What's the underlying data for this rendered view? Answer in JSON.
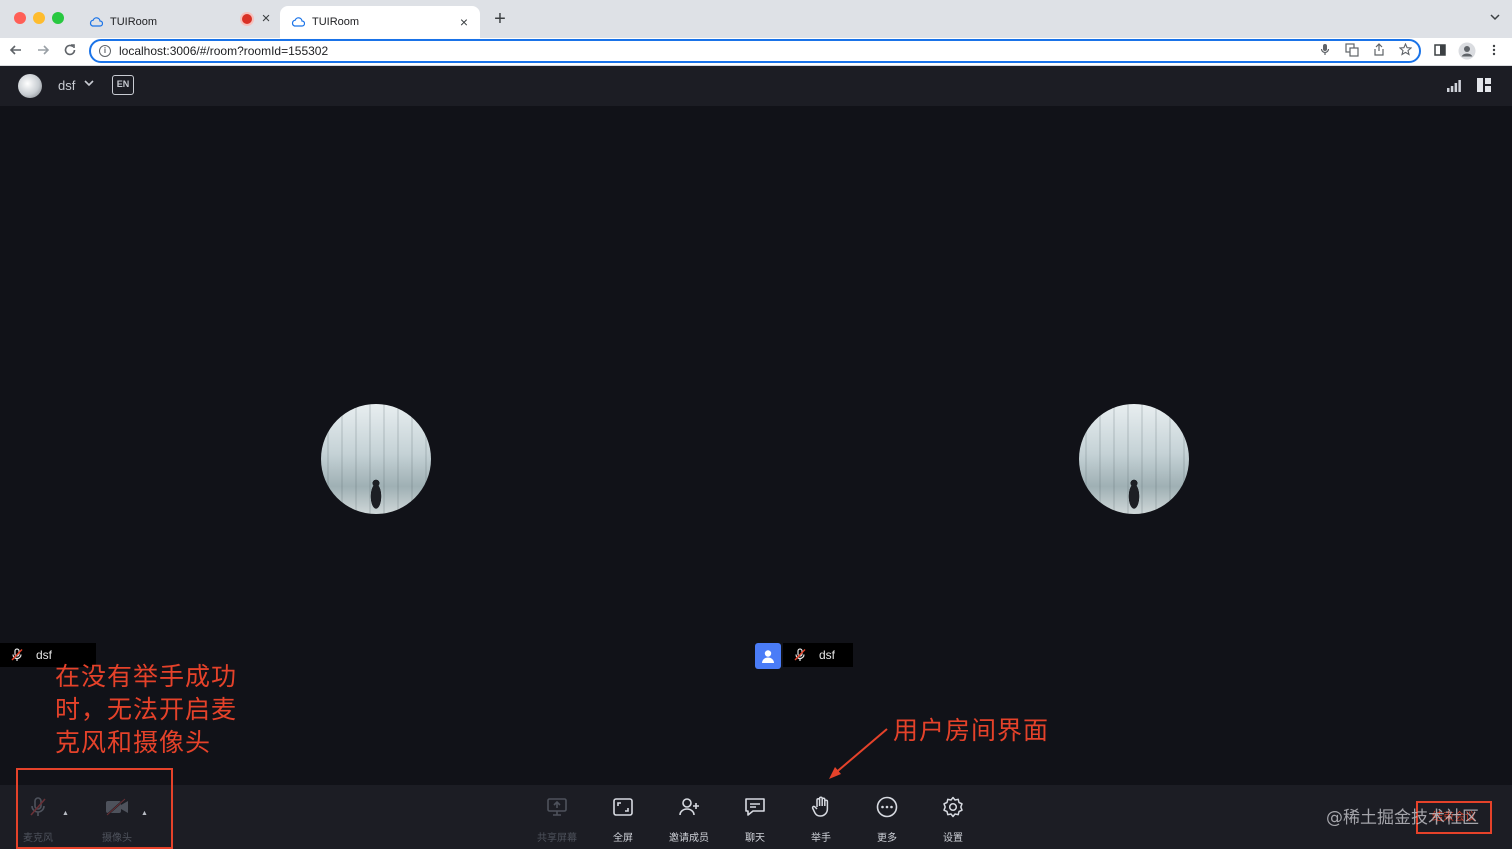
{
  "browser": {
    "tabs": [
      {
        "title": "TUIRoom",
        "recording": true
      },
      {
        "title": "TUIRoom",
        "active": true
      }
    ],
    "url": "localhost:3006/#/room?roomId=155302",
    "new_tab": "+",
    "close": "×"
  },
  "header": {
    "user_name": "dsf",
    "lang_icon": "EN"
  },
  "participants": [
    {
      "name": "dsf"
    },
    {
      "name": "dsf"
    }
  ],
  "annotations": {
    "left_note": [
      "在没有举手成功",
      "时，无法开启麦",
      "克风和摄像头"
    ],
    "right_note": "用户房间界面"
  },
  "controls": {
    "mic": "麦克风",
    "camera": "摄像头",
    "share": "共享屏幕",
    "fullscreen": "全屏",
    "invite": "邀请成员",
    "chat": "聊天",
    "raise_hand": "举手",
    "more": "更多",
    "settings": "设置",
    "end": "结束会议"
  },
  "watermark": "@稀土掘金技术社区",
  "colors": {
    "annotation": "#e5422a",
    "background": "#111218",
    "bar": "#1c1d24",
    "accent": "#1a73e8",
    "user_chip": "#4a7cf7"
  }
}
